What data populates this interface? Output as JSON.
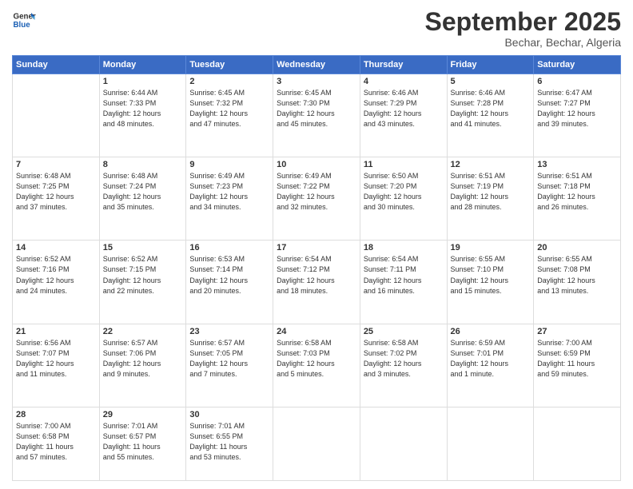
{
  "logo": {
    "line1": "General",
    "line2": "Blue"
  },
  "title": "September 2025",
  "location": "Bechar, Bechar, Algeria",
  "days_of_week": [
    "Sunday",
    "Monday",
    "Tuesday",
    "Wednesday",
    "Thursday",
    "Friday",
    "Saturday"
  ],
  "weeks": [
    [
      {
        "num": "",
        "detail": ""
      },
      {
        "num": "1",
        "detail": "Sunrise: 6:44 AM\nSunset: 7:33 PM\nDaylight: 12 hours\nand 48 minutes."
      },
      {
        "num": "2",
        "detail": "Sunrise: 6:45 AM\nSunset: 7:32 PM\nDaylight: 12 hours\nand 47 minutes."
      },
      {
        "num": "3",
        "detail": "Sunrise: 6:45 AM\nSunset: 7:30 PM\nDaylight: 12 hours\nand 45 minutes."
      },
      {
        "num": "4",
        "detail": "Sunrise: 6:46 AM\nSunset: 7:29 PM\nDaylight: 12 hours\nand 43 minutes."
      },
      {
        "num": "5",
        "detail": "Sunrise: 6:46 AM\nSunset: 7:28 PM\nDaylight: 12 hours\nand 41 minutes."
      },
      {
        "num": "6",
        "detail": "Sunrise: 6:47 AM\nSunset: 7:27 PM\nDaylight: 12 hours\nand 39 minutes."
      }
    ],
    [
      {
        "num": "7",
        "detail": "Sunrise: 6:48 AM\nSunset: 7:25 PM\nDaylight: 12 hours\nand 37 minutes."
      },
      {
        "num": "8",
        "detail": "Sunrise: 6:48 AM\nSunset: 7:24 PM\nDaylight: 12 hours\nand 35 minutes."
      },
      {
        "num": "9",
        "detail": "Sunrise: 6:49 AM\nSunset: 7:23 PM\nDaylight: 12 hours\nand 34 minutes."
      },
      {
        "num": "10",
        "detail": "Sunrise: 6:49 AM\nSunset: 7:22 PM\nDaylight: 12 hours\nand 32 minutes."
      },
      {
        "num": "11",
        "detail": "Sunrise: 6:50 AM\nSunset: 7:20 PM\nDaylight: 12 hours\nand 30 minutes."
      },
      {
        "num": "12",
        "detail": "Sunrise: 6:51 AM\nSunset: 7:19 PM\nDaylight: 12 hours\nand 28 minutes."
      },
      {
        "num": "13",
        "detail": "Sunrise: 6:51 AM\nSunset: 7:18 PM\nDaylight: 12 hours\nand 26 minutes."
      }
    ],
    [
      {
        "num": "14",
        "detail": "Sunrise: 6:52 AM\nSunset: 7:16 PM\nDaylight: 12 hours\nand 24 minutes."
      },
      {
        "num": "15",
        "detail": "Sunrise: 6:52 AM\nSunset: 7:15 PM\nDaylight: 12 hours\nand 22 minutes."
      },
      {
        "num": "16",
        "detail": "Sunrise: 6:53 AM\nSunset: 7:14 PM\nDaylight: 12 hours\nand 20 minutes."
      },
      {
        "num": "17",
        "detail": "Sunrise: 6:54 AM\nSunset: 7:12 PM\nDaylight: 12 hours\nand 18 minutes."
      },
      {
        "num": "18",
        "detail": "Sunrise: 6:54 AM\nSunset: 7:11 PM\nDaylight: 12 hours\nand 16 minutes."
      },
      {
        "num": "19",
        "detail": "Sunrise: 6:55 AM\nSunset: 7:10 PM\nDaylight: 12 hours\nand 15 minutes."
      },
      {
        "num": "20",
        "detail": "Sunrise: 6:55 AM\nSunset: 7:08 PM\nDaylight: 12 hours\nand 13 minutes."
      }
    ],
    [
      {
        "num": "21",
        "detail": "Sunrise: 6:56 AM\nSunset: 7:07 PM\nDaylight: 12 hours\nand 11 minutes."
      },
      {
        "num": "22",
        "detail": "Sunrise: 6:57 AM\nSunset: 7:06 PM\nDaylight: 12 hours\nand 9 minutes."
      },
      {
        "num": "23",
        "detail": "Sunrise: 6:57 AM\nSunset: 7:05 PM\nDaylight: 12 hours\nand 7 minutes."
      },
      {
        "num": "24",
        "detail": "Sunrise: 6:58 AM\nSunset: 7:03 PM\nDaylight: 12 hours\nand 5 minutes."
      },
      {
        "num": "25",
        "detail": "Sunrise: 6:58 AM\nSunset: 7:02 PM\nDaylight: 12 hours\nand 3 minutes."
      },
      {
        "num": "26",
        "detail": "Sunrise: 6:59 AM\nSunset: 7:01 PM\nDaylight: 12 hours\nand 1 minute."
      },
      {
        "num": "27",
        "detail": "Sunrise: 7:00 AM\nSunset: 6:59 PM\nDaylight: 11 hours\nand 59 minutes."
      }
    ],
    [
      {
        "num": "28",
        "detail": "Sunrise: 7:00 AM\nSunset: 6:58 PM\nDaylight: 11 hours\nand 57 minutes."
      },
      {
        "num": "29",
        "detail": "Sunrise: 7:01 AM\nSunset: 6:57 PM\nDaylight: 11 hours\nand 55 minutes."
      },
      {
        "num": "30",
        "detail": "Sunrise: 7:01 AM\nSunset: 6:55 PM\nDaylight: 11 hours\nand 53 minutes."
      },
      {
        "num": "",
        "detail": ""
      },
      {
        "num": "",
        "detail": ""
      },
      {
        "num": "",
        "detail": ""
      },
      {
        "num": "",
        "detail": ""
      }
    ]
  ]
}
